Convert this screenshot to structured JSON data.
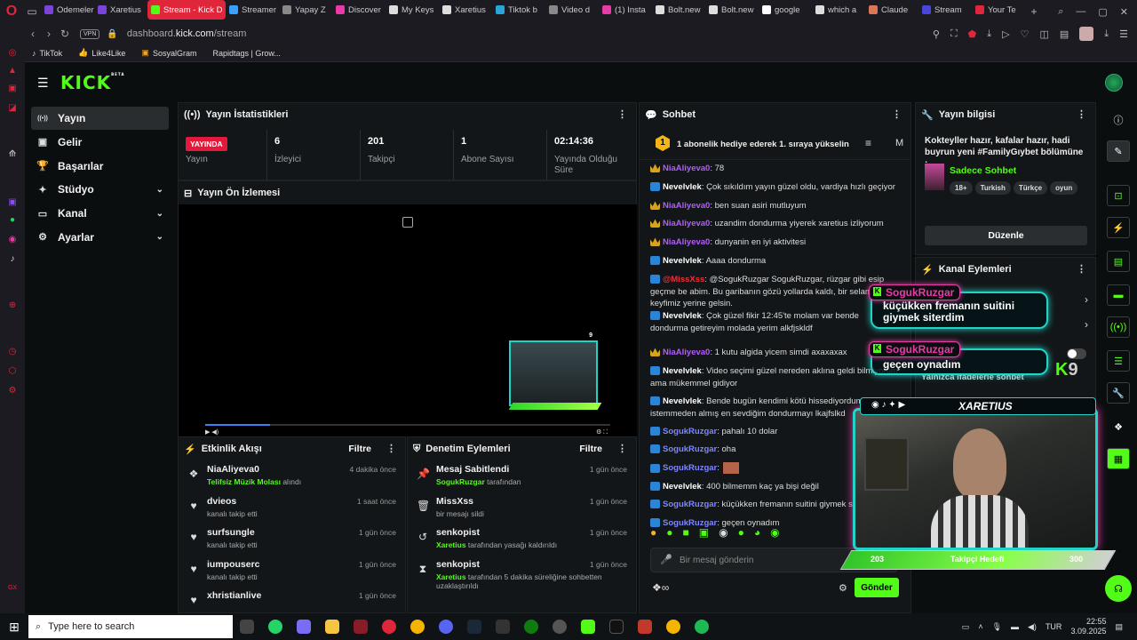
{
  "browser": {
    "tabs": [
      {
        "label": "Odemeler",
        "color": "#7b44d9"
      },
      {
        "label": "Xaretius",
        "color": "#7b44d9"
      },
      {
        "label": "Stream - Kick D",
        "color": "#53fc18",
        "active": true
      },
      {
        "label": "Streamer",
        "color": "#3aa0ff"
      },
      {
        "label": "Yapay Z",
        "color": "#888"
      },
      {
        "label": "Discover",
        "color": "#e83aa8"
      },
      {
        "label": "My Keys",
        "color": "#ddd"
      },
      {
        "label": "Xaretius",
        "color": "#ddd"
      },
      {
        "label": "Tiktok b",
        "color": "#2aa5d9"
      },
      {
        "label": "Video d",
        "color": "#888"
      },
      {
        "label": "(1) Insta",
        "color": "#e83aa8"
      },
      {
        "label": "Bolt.new",
        "color": "#ddd"
      },
      {
        "label": "Bolt.new",
        "color": "#ddd"
      },
      {
        "label": "google",
        "color": "#fff"
      },
      {
        "label": "which a",
        "color": "#ddd"
      },
      {
        "label": "Claude",
        "color": "#d97757"
      },
      {
        "label": "Stream",
        "color": "#4a46d9"
      },
      {
        "label": "Your Te",
        "color": "#e0263a"
      }
    ],
    "vpn_label": "VPN",
    "url_host": "dashboard.",
    "url_domain": "kick.com",
    "url_path": "/stream",
    "bookmarks": [
      "TikTok",
      "Like4Like",
      "SosyalGram",
      "Rapidtags | Grow..."
    ]
  },
  "sidebar": {
    "items": [
      {
        "label": "Yayın",
        "icon": "broadcast-icon",
        "glyph": "((•))",
        "active": true
      },
      {
        "label": "Gelir",
        "icon": "wallet-icon",
        "glyph": "▣"
      },
      {
        "label": "Başarılar",
        "icon": "trophy-icon",
        "glyph": "🏆"
      },
      {
        "label": "Stüdyo",
        "icon": "studio-icon",
        "glyph": "✦",
        "expandable": true
      },
      {
        "label": "Kanal",
        "icon": "channel-icon",
        "glyph": "▭",
        "expandable": true
      },
      {
        "label": "Ayarlar",
        "icon": "settings-icon",
        "glyph": "⚙",
        "expandable": true
      }
    ]
  },
  "stats": {
    "title": "Yayın İstatistikleri",
    "live_label": "YAYINDA",
    "live_sub": "Yayın",
    "cells": [
      {
        "value": "6",
        "label": "İzleyici"
      },
      {
        "value": "201",
        "label": "Takipçi"
      },
      {
        "value": "1",
        "label": "Abone Sayısı"
      },
      {
        "value": "02:14:36",
        "label": "Yayında Olduğu Süre"
      }
    ]
  },
  "preview": {
    "title": "Yayın Ön İzlemesi",
    "progress": 0.16
  },
  "activity": {
    "title": "Etkinlik Akışı",
    "filter": "Filtre",
    "items": [
      {
        "name": "NiaAliyeva0",
        "sub_green": "Telifsiz Müzik Molası",
        "sub": " alındı",
        "time": "4 dakika önce",
        "icon": "gift-icon",
        "glyph": "❖"
      },
      {
        "name": "dvieos",
        "sub_green": "",
        "sub": "kanalı takip etti",
        "time": "1 saat önce",
        "icon": "heart-icon",
        "glyph": "♥"
      },
      {
        "name": "surfsungle",
        "sub_green": "",
        "sub": "kanalı takip etti",
        "time": "1 gün önce",
        "icon": "heart-icon",
        "glyph": "♥"
      },
      {
        "name": "iumpouserc",
        "sub_green": "",
        "sub": "kanalı takip etti",
        "time": "1 gün önce",
        "icon": "heart-icon",
        "glyph": "♥"
      },
      {
        "name": "xhristianlive",
        "sub_green": "",
        "sub": "",
        "time": "1 gün önce",
        "icon": "heart-icon",
        "glyph": "♥"
      }
    ]
  },
  "moderation": {
    "title": "Denetim Eylemleri",
    "filter": "Filtre",
    "items": [
      {
        "name": "Mesaj Sabitlendi",
        "sub_green": "SogukRuzgar",
        "sub": " tarafından",
        "time": "1 gün önce",
        "icon": "pin-icon",
        "glyph": "📌"
      },
      {
        "name": "MissXss",
        "sub_green": "",
        "sub": "bir mesajı sildi",
        "time": "1 gün önce",
        "icon": "trash-icon",
        "glyph": "🗑"
      },
      {
        "name": "senkopist",
        "sub_green": "Xaretius",
        "sub": " tarafından yasağı kaldırıldı",
        "time": "1 gün önce",
        "icon": "undo-icon",
        "glyph": "↺"
      },
      {
        "name": "senkopist",
        "sub_green": "Xaretius",
        "sub": " tarafından 5 dakika süreliğine sohbetten uzaklaştırıldı",
        "time": "1 gün önce",
        "icon": "hourglass-icon",
        "glyph": "⧗"
      }
    ]
  },
  "chat": {
    "title": "Sohbet",
    "pinned": "1 abonelik hediye ederek 1. sıraya yükselin",
    "pinned_rank": "1",
    "messages": [
      {
        "badge": "crown",
        "user": "NiaAliyeva0",
        "color": "purple",
        "text": ": 78"
      },
      {
        "badge": "kick",
        "user": "Nevelvlek",
        "color": "white",
        "text": ": Çok sıkıldım yayın güzel oldu, vardiya hızlı geçiyor"
      },
      {
        "badge": "crown",
        "user": "NiaAliyeva0",
        "color": "purple",
        "text": ": ben suan asiri mutluyum"
      },
      {
        "badge": "crown",
        "user": "NiaAliyeva0",
        "color": "purple",
        "text": ": uzandim dondurma yiyerek xaretius izliyorum"
      },
      {
        "badge": "crown",
        "user": "NiaAliyeva0",
        "color": "purple",
        "text": ": dunyanin en iyi aktivitesi"
      },
      {
        "badge": "kick",
        "user": "Nevelvlek",
        "color": "white",
        "text": ": Aaaa dondurma"
      },
      {
        "badge": "kick",
        "user": "@MissXss",
        "color": "red",
        "text": ": @SogukRuzgar SogukRuzgar, rüzgar gibi esip geçme be abim. Bu garibanın gözü yollarda kaldı, bir selam ver de keyfimiz yerine gelsin."
      },
      {
        "badge": "kick",
        "user": "Nevelvlek",
        "color": "white",
        "text": ": Çok güzel fikir 12:45'te molam var bende dondurma getireyim molada yerim alkfjskldf"
      },
      {
        "badge": "crown",
        "user": "NiaAliyeva0",
        "color": "purple",
        "text": ": 1 kutu algida yicem simdi axaxaxax"
      },
      {
        "badge": "kick",
        "user": "Nevelvlek",
        "color": "white",
        "text": ": Video seçimi güzel nereden aklına geldi bilmiyorum ama mükemmel gidiyor"
      },
      {
        "badge": "kick",
        "user": "Nevelvlek",
        "color": "white",
        "text": ": Bende bugün kendimi kötü hissediyordum istemmeden almış en sevdiğim dondurmayı lkajfslkd"
      },
      {
        "badge": "kick",
        "user": "SogukRuzgar",
        "color": "blue",
        "text": ": pahalı 10 dolar"
      },
      {
        "badge": "kick",
        "user": "SogukRuzgar",
        "color": "blue",
        "text": ": oha"
      },
      {
        "badge": "kick",
        "user": "SogukRuzgar",
        "color": "blue",
        "text": ":"
      },
      {
        "badge": "kick",
        "user": "Nevelvlek",
        "color": "white",
        "text": ": 400 bilmemm kaç ya bişi değil"
      },
      {
        "badge": "kick",
        "user": "SogukRuzgar",
        "color": "blue",
        "text": ": küçükken fremanın suitini giymek siterdim"
      },
      {
        "badge": "kick",
        "user": "SogukRuzgar",
        "color": "blue",
        "text": ": geçen oynadım"
      }
    ],
    "input_placeholder": "Bir mesaj gönderin",
    "send_label": "Gönder"
  },
  "stream_info": {
    "title": "Yayın bilgisi",
    "stream_title": "Kokteyller hazır, kafalar hazır, hadi buyrun yeni #FamilyGıybet bölümüne :...",
    "category": "Sadece Sohbet",
    "tags": [
      "18+",
      "Turkish",
      "Türkçe",
      "oyun"
    ],
    "edit_label": "Düzenle"
  },
  "channel_actions": {
    "title": "Kanal Eylemleri",
    "partial_label": "Yalnızca ifadelerle sohbet"
  },
  "overlay": {
    "alerts": [
      {
        "user": "SogukRuzgar",
        "message": "küçükken fremanın suitini giymek siterdim"
      },
      {
        "user": "SogukRuzgar",
        "message": "geçen oynadım"
      }
    ],
    "viewer_badge": "9",
    "thumb_viewers": "9",
    "cam_name": "XARETIUS",
    "follow_left": "203",
    "follow_label": "Takipçi Hedefi",
    "follow_right": "300"
  },
  "taskbar": {
    "search_placeholder": "Type here to search",
    "lang": "TUR",
    "time": "22:55",
    "date": "3.09.2025"
  },
  "colors": {
    "kick_green": "#53fc18",
    "live_red": "#e3193c",
    "neon_cyan": "#22d3c8",
    "neon_pink": "#e83aa8"
  }
}
